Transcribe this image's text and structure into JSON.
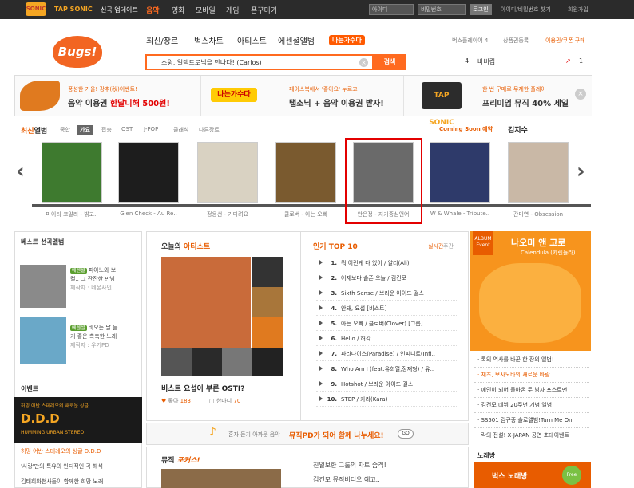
{
  "topbar": {
    "sonic_logo": "SONIC",
    "tapsonic": "TAP SONIC",
    "tapsonic_sub": "신곡 업데이트",
    "menu": [
      "음악",
      "영화",
      "모바일",
      "게임",
      "폰꾸미기"
    ],
    "id_placeholder": "아이디",
    "pw_placeholder": "비밀번호",
    "login": "로그인",
    "find": "아이디/비밀번호 찾기",
    "join": "회원가입"
  },
  "header": {
    "logo": "Bugs!",
    "nav": [
      "최신/장르",
      "벅스차트",
      "아티스트",
      "에센셜앨범"
    ],
    "nav_banner": "나는가수다",
    "right_links": [
      "벅스플레이어 4",
      "상품권등록",
      "이용권/쿠폰 구매"
    ],
    "search_value": "스윙, 일렉트로닉을 만나다! (Carlos)",
    "search_button": "검색",
    "rank_num": "4.",
    "rank_text": "바비킴",
    "rank_change": "1"
  },
  "banners": [
    {
      "line1": "풍성한 가을! 강추(秋)이벤트!",
      "line2_pre": "음악 이용권 ",
      "line2_em": "한달니해 500원!"
    },
    {
      "logo": "나는가수다",
      "line1": "페이스북에서 '좋아요' 누르고",
      "line2": "탭소닉 + 음악 이용권 받자!"
    },
    {
      "logo": "TAP SONIC",
      "line1": "한 번 구매로 무제한 플레이~",
      "line2": "프리미엄 뮤직 40% 세일"
    }
  ],
  "albums": {
    "title_pre": "최신",
    "title": "앨범",
    "tabs": [
      "종합",
      "가요",
      "팝송",
      "OST",
      "J-POP",
      "클래식",
      "다른장르"
    ],
    "coming": "Coming Soon 예약",
    "coming_artist": "김지수",
    "items": [
      {
        "title": "마이티 코알라 - 밝고..",
        "color": "#3e7a2f"
      },
      {
        "title": "Glen Check - Au Re..",
        "color": "#1d1d1d"
      },
      {
        "title": "정용선 - 기다려요",
        "color": "#d9d2c2"
      },
      {
        "title": "클로버 - 아는 오빠",
        "color": "#7a5a2f"
      },
      {
        "title": "안은정 - 자기중심언어",
        "color": "#6a6a6a"
      },
      {
        "title": "W & Whale - Tribute..",
        "color": "#2e3a6a"
      },
      {
        "title": "간미연 - Obsession",
        "color": "#c9b8a6"
      }
    ]
  },
  "best": {
    "title": "베스트 선곡앨범",
    "items": [
      {
        "badge": "에센셜",
        "text1": "피아노와 보",
        "text2": "컬.. 그 잔잔한 만남",
        "maker": "제작자 : 네온사인"
      },
      {
        "badge": "에센셜",
        "text1": "비오는 날 듣",
        "text2": "기 좋은 촉촉한 노래",
        "maker": "제작자 : 우기PD"
      }
    ],
    "event_title": "이벤트",
    "event_banner_top": "허밍 어반 스테레오의 새로운 싱글",
    "event_banner_big": "D.D.D",
    "event_banner_sub": "HUMMING URBAN STEREO",
    "event_links": [
      "허밍 어반 스테레오의 싱글 D.D.D",
      "'사랑'만의 특유의 인디적인 곡 해석",
      "김태희와천사들이 함께한 희망 노래"
    ]
  },
  "artist": {
    "title_pre": "오늘의",
    "title": "아티스트",
    "caption": "비스트 요섭이 부른 OSTI?",
    "like": "좋아",
    "like_count": "183",
    "comment": "한마디",
    "comment_count": "70"
  },
  "top10": {
    "title": "인기 TOP 10",
    "realtime": "실시간",
    "weekly": "주간",
    "items": [
      "뭐 이런게 다 있어 / 알리(Ali)",
      "어제보다 슬픈 오늘 / 김건모",
      "Sixth Sense / 브라운 아이드 걸스",
      "안돼, 요섭 [비스트]",
      "아는 오빠 / 클로버(Clover) [그룹]",
      "Hello / 허각",
      "파라다이스(Paradise) / 인피니트(Infi..",
      "Who Am I (feat.유희열,정재형) / 유..",
      "Hotshot / 브라운 아이드 걸스",
      "STEP / 카라(Kara)"
    ]
  },
  "promo": {
    "text_pre": "혼자 듣기 아까운 음악",
    "text_em": "뮤직PD가 되어 함께 나누세요!",
    "go": "GO"
  },
  "musicfocus": {
    "title": "뮤직",
    "title_em": "포커스!",
    "line1": "진일보한 그룹의 차트 습격!",
    "line2": "김건모 뮤직비디오 예고.."
  },
  "right": {
    "album_event": "ALBUM Event",
    "name": "나오미 앤 고로",
    "sub": "Calendula (카렌듈라)",
    "links": [
      "록의 역사를 바꾼 한 장의 앨범!",
      "재즈, 보사노바의 새로운 바람",
      "애인이 되어 돌아온 두 남자 포스트맨",
      "김건모 데뷔 20주년 기념 앨범!",
      "SS501 김규종 솔로앨범!Turn Me On",
      "락의 전설! X-JAPAN 공연 초대이벤트"
    ],
    "karaoke": "노래방",
    "karaoke_banner": "벅스 노래방",
    "free": "Free"
  }
}
